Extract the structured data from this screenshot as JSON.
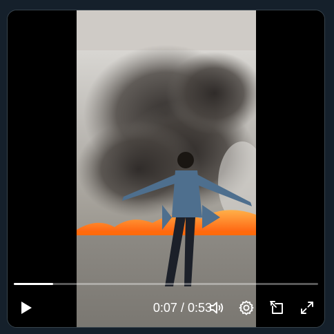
{
  "player": {
    "current_time": "0:07",
    "separator": " / ",
    "duration": "0:53",
    "progress_fraction": 0.13
  },
  "controls": {
    "play_icon": "play-icon",
    "volume_icon": "volume-icon",
    "settings_icon": "gear-icon",
    "popout_icon": "picture-in-picture-icon",
    "fullscreen_icon": "fullscreen-icon"
  },
  "colors": {
    "page_background": "#15202b",
    "player_background": "#000000",
    "control_icon": "#ffffff",
    "fire": "#ff7a12",
    "smoke": "#3a3633"
  }
}
